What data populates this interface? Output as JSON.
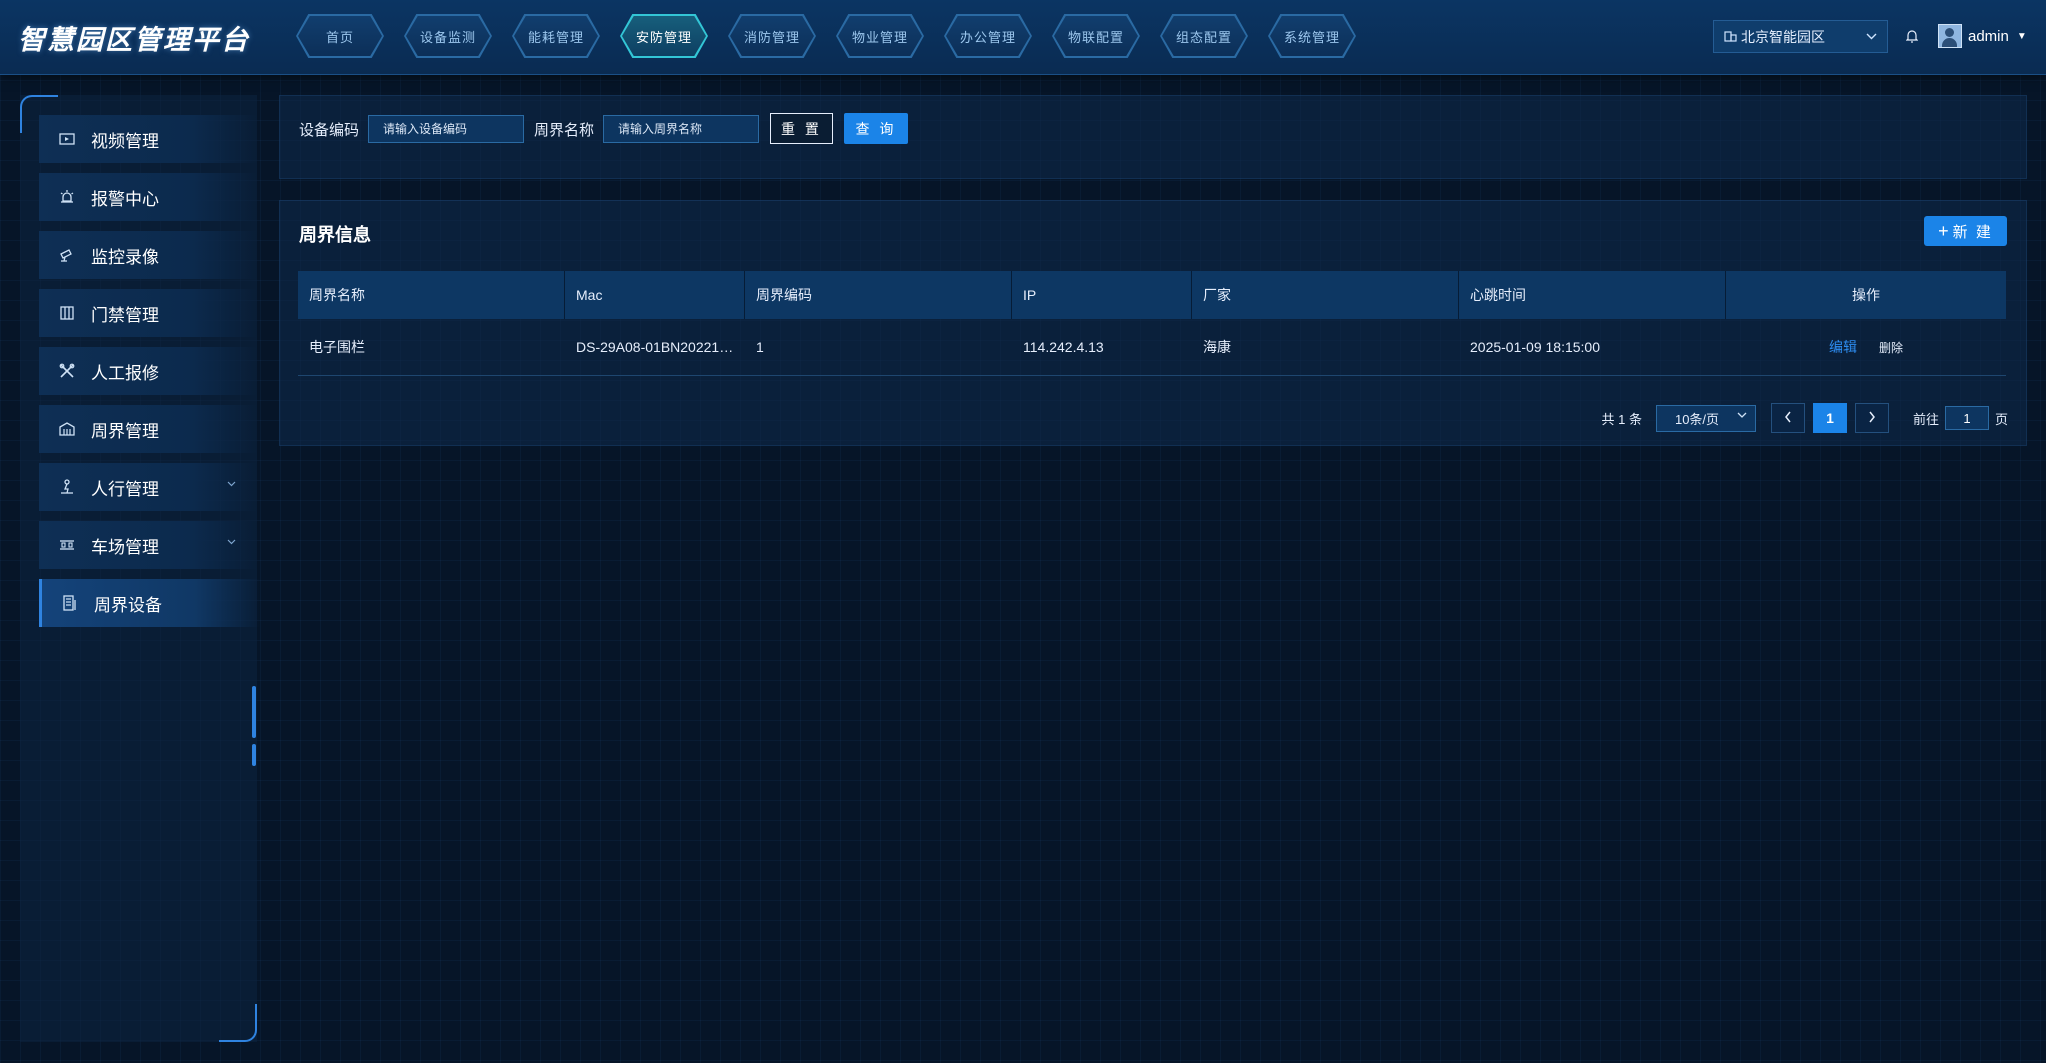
{
  "app": {
    "title": "智慧园区管理平台"
  },
  "nav": [
    {
      "label": "首页",
      "active": false
    },
    {
      "label": "设备监测",
      "active": false
    },
    {
      "label": "能耗管理",
      "active": false
    },
    {
      "label": "安防管理",
      "active": true
    },
    {
      "label": "消防管理",
      "active": false
    },
    {
      "label": "物业管理",
      "active": false
    },
    {
      "label": "办公管理",
      "active": false
    },
    {
      "label": "物联配置",
      "active": false
    },
    {
      "label": "组态配置",
      "active": false
    },
    {
      "label": "系统管理",
      "active": false
    }
  ],
  "park": {
    "value": "北京智能园区",
    "icon": "building-icon"
  },
  "user": {
    "name": "admin",
    "icon": "bell-icon"
  },
  "sidebar": {
    "items": [
      {
        "label": "视频管理",
        "icon": "video-icon"
      },
      {
        "label": "报警中心",
        "icon": "alarm-icon"
      },
      {
        "label": "监控录像",
        "icon": "camera-icon"
      },
      {
        "label": "门禁管理",
        "icon": "gate-icon"
      },
      {
        "label": "人工报修",
        "icon": "tools-icon"
      },
      {
        "label": "周界管理",
        "icon": "perimeter-icon"
      },
      {
        "label": "人行管理",
        "icon": "pedestrian-icon",
        "expandable": true
      },
      {
        "label": "车场管理",
        "icon": "parking-icon",
        "expandable": true
      },
      {
        "label": "周界设备",
        "icon": "device-icon",
        "active": true
      }
    ]
  },
  "filter": {
    "device_code_label": "设备编码",
    "device_code_placeholder": "请输入设备编码",
    "perimeter_name_label": "周界名称",
    "perimeter_name_placeholder": "请输入周界名称",
    "reset_label": "重 置",
    "query_label": "查 询"
  },
  "list": {
    "title": "周界信息",
    "new_label": "新 建",
    "columns": [
      "周界名称",
      "Mac",
      "周界编码",
      "IP",
      "厂家",
      "心跳时间",
      "操作"
    ],
    "rows": [
      {
        "name": "电子围栏",
        "mac": "DS-29A08-01BN20221…",
        "code": "1",
        "ip": "114.242.4.13",
        "vendor": "海康",
        "heartbeat": "2025-01-09 18:15:00",
        "edit_label": "编辑",
        "delete_label": "删除"
      }
    ]
  },
  "pagination": {
    "total_text": "共 1 条",
    "page_size": "10条/页",
    "prev_icon": "‹",
    "current_page": "1",
    "next_icon": "›",
    "goto_label": "前往",
    "goto_value": "1",
    "page_suffix": "页"
  },
  "colors": {
    "accent": "#1b84e8",
    "active_nav": "#33c6d6",
    "background": "#061528"
  }
}
